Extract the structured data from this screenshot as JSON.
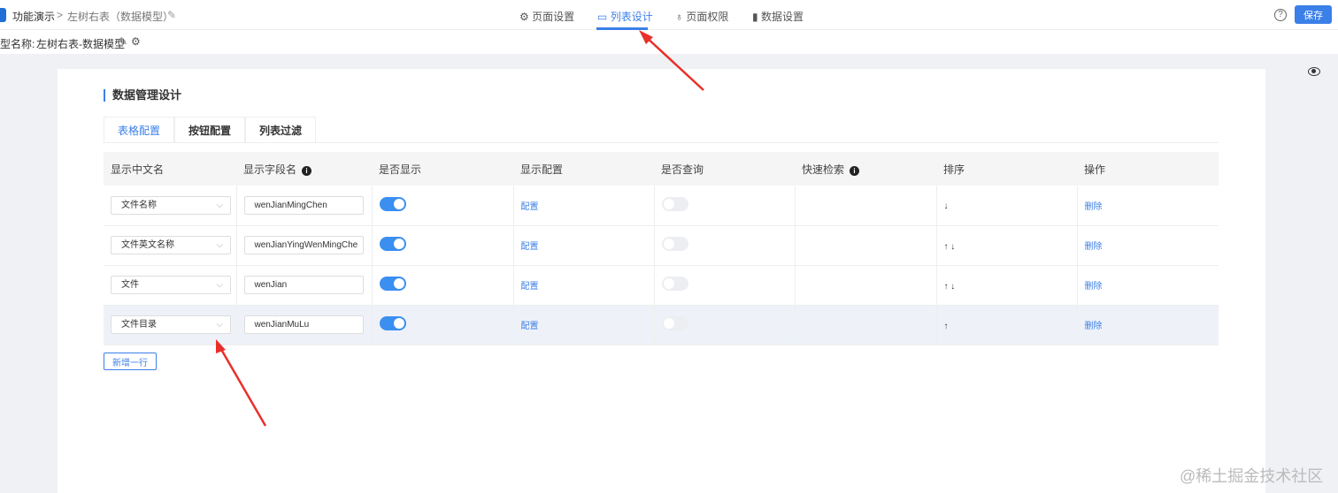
{
  "header": {
    "breadcrumb_root": "功能演示",
    "breadcrumb_current": "左树右表（数据模型）",
    "save_label": "保存",
    "help": "?",
    "nav": [
      {
        "label": "页面设置",
        "icon": "⚙"
      },
      {
        "label": "列表设计",
        "icon": "▭"
      },
      {
        "label": "页面权限",
        "icon": "♁"
      },
      {
        "label": "数据设置",
        "icon": "▮"
      }
    ]
  },
  "subbar": {
    "label": "型名称:",
    "model_name": "左树右表-数据模型"
  },
  "section": {
    "title": "数据管理设计",
    "tabs": [
      "表格配置",
      "按钮配置",
      "列表过滤"
    ]
  },
  "table": {
    "headers": [
      "显示中文名",
      "显示字段名",
      "是否显示",
      "显示配置",
      "是否查询",
      "快速检索",
      "排序",
      "操作"
    ],
    "rows": [
      {
        "name": "文件名称",
        "field": "wenJianMingChen",
        "show": true,
        "config": "配置",
        "query": false,
        "sort": "↓",
        "action": "删除"
      },
      {
        "name": "文件英文名称",
        "field": "wenJianYingWenMingChe",
        "show": true,
        "config": "配置",
        "query": false,
        "sort": "↑ ↓",
        "action": "删除"
      },
      {
        "name": "文件",
        "field": "wenJian",
        "show": true,
        "config": "配置",
        "query": false,
        "sort": "↑ ↓",
        "action": "删除"
      },
      {
        "name": "文件目录",
        "field": "wenJianMuLu",
        "show": true,
        "config": "配置",
        "query": false,
        "sort": "↑",
        "action": "删除"
      }
    ]
  },
  "add_row_label": "新增一行",
  "watermark": "@稀土掘金技术社区"
}
